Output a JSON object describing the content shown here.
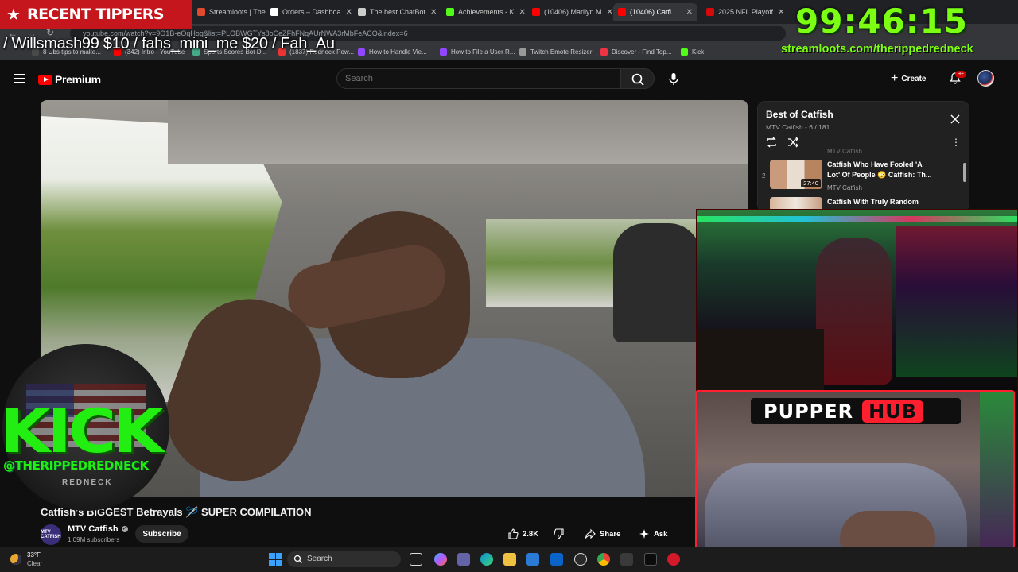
{
  "browser": {
    "tabs": [
      {
        "label": "Streamloots | The",
        "color": "#e04a2f",
        "active": false
      },
      {
        "label": "Orders – Dashboa",
        "color": "#fff",
        "active": false
      },
      {
        "label": "The best ChatBot",
        "color": "#ccc",
        "active": false
      },
      {
        "label": "Achievements - K",
        "color": "#53fc18",
        "active": false
      },
      {
        "label": "(10406) Marilyn M",
        "color": "#ff0000",
        "active": false
      },
      {
        "label": "(10406) Catfi",
        "color": "#ff0000",
        "active": true
      },
      {
        "label": "2025 NFL Playoff",
        "color": "#d50a0a",
        "active": false
      }
    ],
    "url": "youtube.com/watch?v=9O1B-eOqHog&list=PLOBWGTYs8oCeZFhFNqAUrNWA3rMbFeACQ&index=6",
    "bookmarks": [
      {
        "label": "8 Ubs tips to make...",
        "color": "#4a4a4a"
      },
      {
        "label": "(342) Intro - YouTube",
        "color": "#ff0000"
      },
      {
        "label": "Sports Scores Bot D...",
        "color": "#4a8"
      },
      {
        "label": "(1837) Redneck Pow...",
        "color": "#e33"
      },
      {
        "label": "How to Handle Vie...",
        "color": "#9146ff"
      },
      {
        "label": "How to File a User R...",
        "color": "#9146ff"
      },
      {
        "label": "Twitch Emote Resizer",
        "color": "#999"
      },
      {
        "label": "Discover - Find Top...",
        "color": "#e34"
      },
      {
        "label": "Kick",
        "color": "#53fc18"
      }
    ]
  },
  "overlay": {
    "recent_tippers_label": "RECENT TIPPERS",
    "tippers_text": "/ Willsmash99 $10 / fahs_mini_me $20 / Fah_Au",
    "timer": "99:46:15",
    "timer_url": "streamloots.com/therippedredneck",
    "kick_word": "KICK",
    "kick_handle": "@THERIPPEDREDNECK",
    "kick_sub": "REDNECK",
    "pupper_left": "PUPPER",
    "pupper_right": "HUB"
  },
  "youtube": {
    "logo_text": "Premium",
    "search_placeholder": "Search",
    "create_label": "Create",
    "notif_badge": "9+",
    "video_title": "Catfish's BIGGEST Betrayals 🪡 SUPER COMPILATION",
    "channel_name": "MTV Catfish",
    "channel_avatar_text": "MTV CATFISH",
    "subscribers": "1.09M subscribers",
    "subscribe_label": "Subscribe",
    "like_count": "2.8K",
    "share_label": "Share",
    "ask_label": "Ask"
  },
  "playlist": {
    "title": "Best of Catfish",
    "meta": "MTV Catfish - 6 / 181",
    "prev_channel": "MTV Catfish",
    "items": [
      {
        "index": "2",
        "title_line1": "Catfish Who Have Fooled 'A",
        "title_line2": "Lot' Of People 😳 Catfish: Th...",
        "channel": "MTV Catfish",
        "duration": "27:40"
      },
      {
        "index": "3",
        "title_line1": "Catfish With Truly Random",
        "title_line2": "",
        "channel": "",
        "duration": ""
      }
    ]
  },
  "taskbar": {
    "temperature": "33°F",
    "condition": "Clear",
    "search_label": "Search"
  }
}
